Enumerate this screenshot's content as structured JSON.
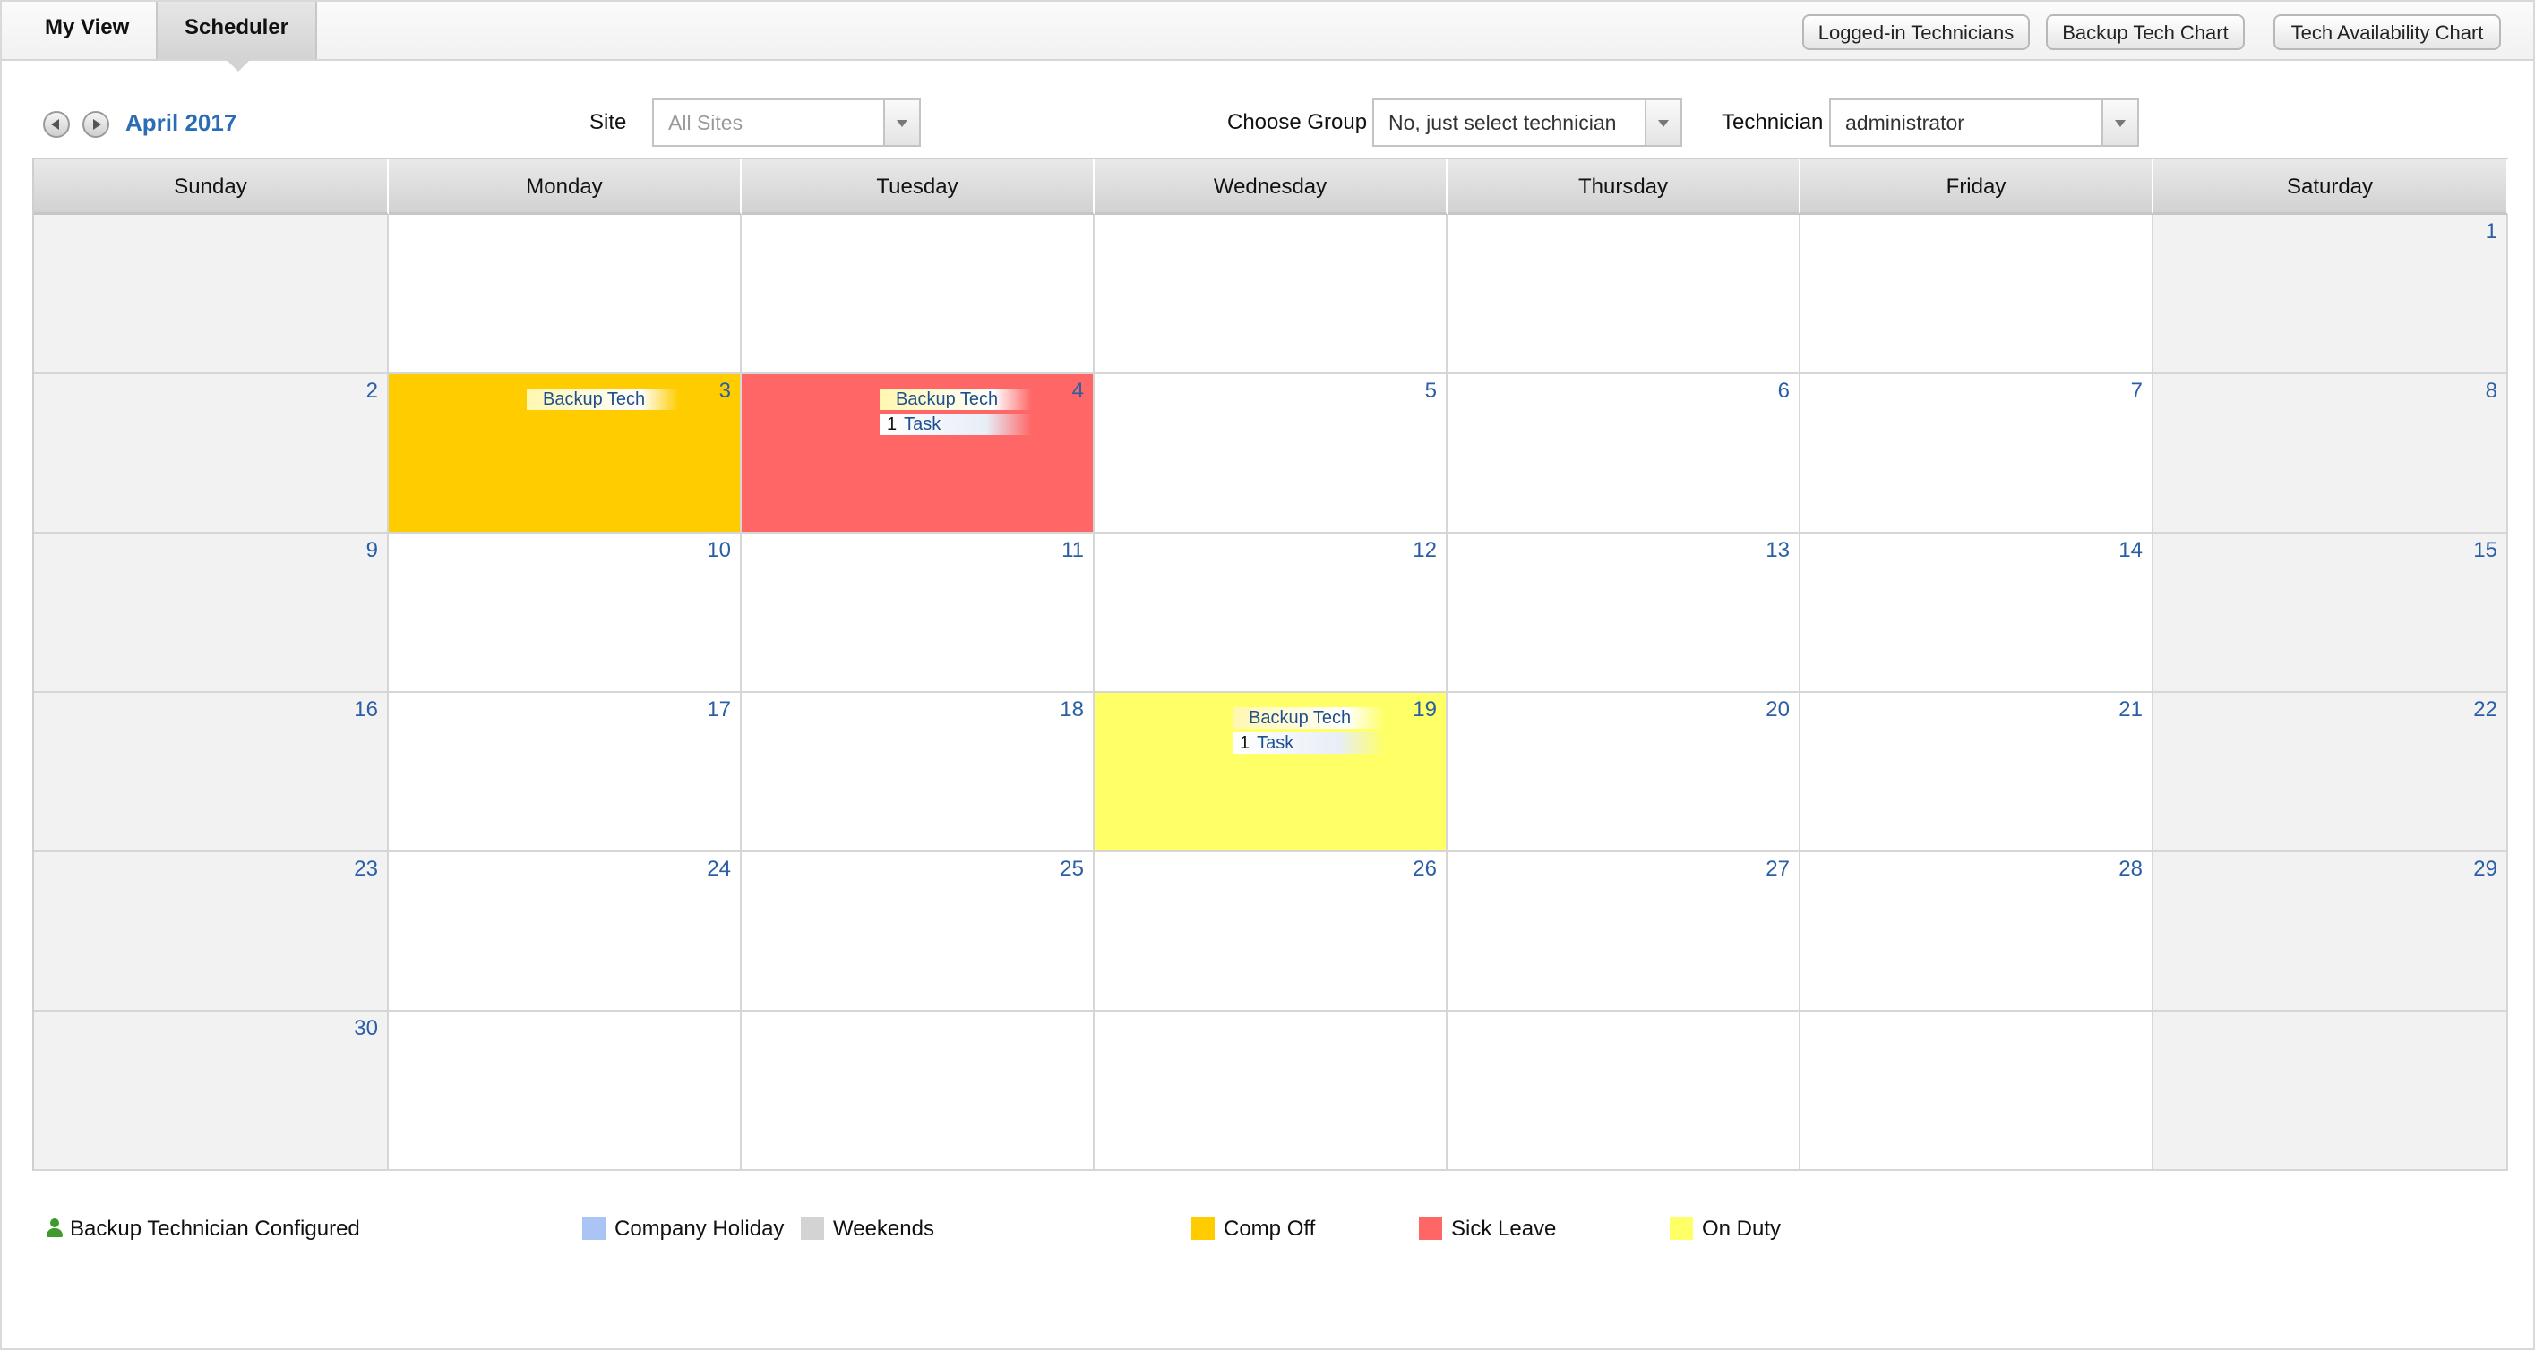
{
  "tabs": [
    {
      "label": "My View",
      "active": false
    },
    {
      "label": "Scheduler",
      "active": true
    }
  ],
  "top_buttons": [
    "Logged-in Technicians",
    "Backup Tech Chart",
    "Tech Availability Chart"
  ],
  "toolbar": {
    "month_label": "April 2017",
    "site_label": "Site",
    "site_placeholder": "All Sites",
    "group_label": "Choose Group",
    "group_value": "No, just select technician",
    "technician_label": "Technician",
    "technician_value": "administrator"
  },
  "calendar": {
    "day_headers": [
      "Sunday",
      "Monday",
      "Tuesday",
      "Wednesday",
      "Thursday",
      "Friday",
      "Saturday"
    ],
    "weeks": [
      [
        "",
        "",
        "",
        "",
        "",
        "",
        "1"
      ],
      [
        "2",
        "3",
        "4",
        "5",
        "6",
        "7",
        "8"
      ],
      [
        "9",
        "10",
        "11",
        "12",
        "13",
        "14",
        "15"
      ],
      [
        "16",
        "17",
        "18",
        "19",
        "20",
        "21",
        "22"
      ],
      [
        "23",
        "24",
        "25",
        "26",
        "27",
        "28",
        "29"
      ],
      [
        "30",
        "",
        "",
        "",
        "",
        "",
        ""
      ]
    ],
    "status_days": {
      "3": "compoff",
      "4": "sickleave",
      "19": "onduty"
    },
    "events": {
      "3": {
        "backup": "Backup Tech"
      },
      "4": {
        "backup": "Backup Tech",
        "task_count": "1",
        "task_label": "Task"
      },
      "19": {
        "backup": "Backup Tech",
        "task_count": "1",
        "task_label": "Task"
      }
    }
  },
  "legend": [
    {
      "label": "Backup Technician Configured",
      "icon": "person-icon",
      "color": "#3f9a2e"
    },
    {
      "label": "Company Holiday",
      "color": "#a9c4f5"
    },
    {
      "label": "Weekends",
      "color": "#d3d3d3"
    },
    {
      "label": "Comp Off",
      "color": "#ffcc00"
    },
    {
      "label": "Sick Leave",
      "color": "#ff6666"
    },
    {
      "label": "On Duty",
      "color": "#ffff66"
    }
  ]
}
